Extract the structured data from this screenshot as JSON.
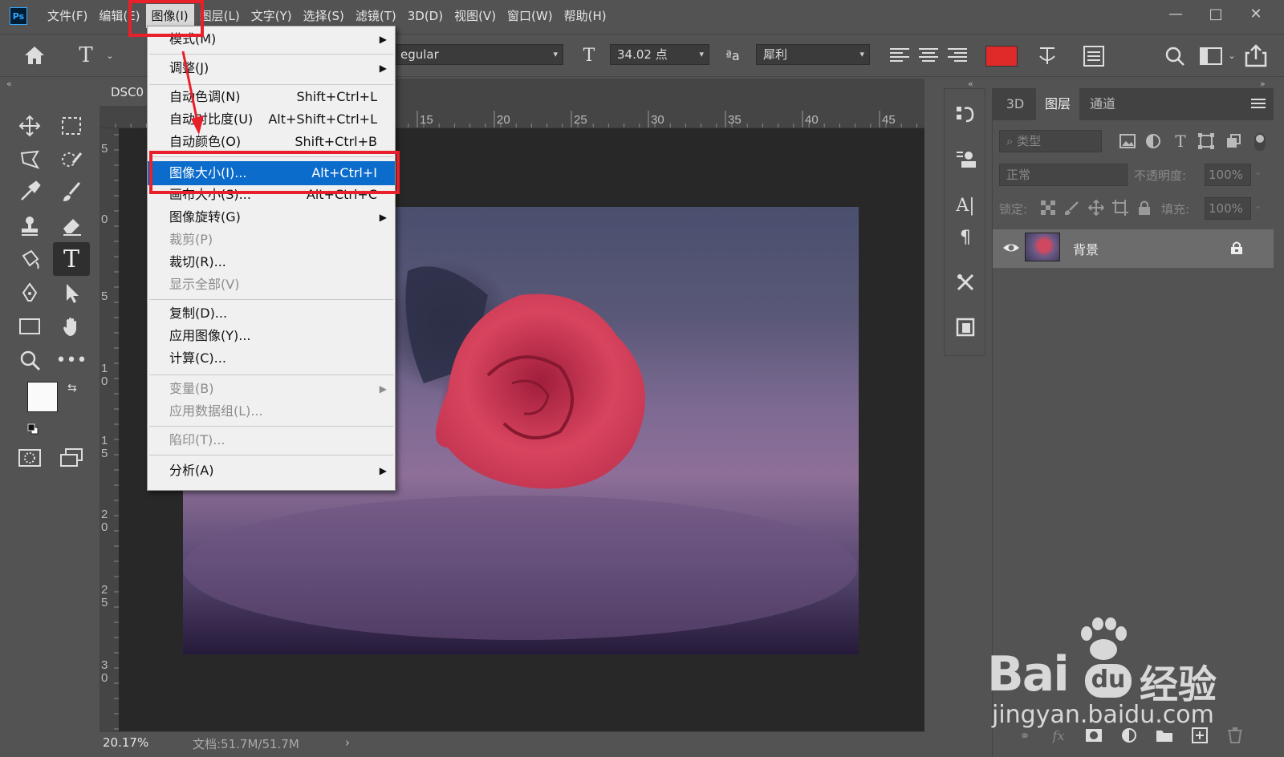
{
  "menubar": {
    "logo": "Ps",
    "items": [
      "文件(F)",
      "编辑(E)",
      "图像(I)",
      "图层(L)",
      "文字(Y)",
      "选择(S)",
      "滤镜(T)",
      "3D(D)",
      "视图(V)",
      "窗口(W)",
      "帮助(H)"
    ]
  },
  "window_controls": {
    "minimize": "—",
    "maximize": "□",
    "close": "✕"
  },
  "options": {
    "font_style": "egular",
    "font_size": "34.02 点",
    "aa_label": "ªa",
    "antialias": "犀利",
    "text_color": "#e02a2a"
  },
  "document": {
    "tab": "DSC0",
    "zoom": "20.17%",
    "doc_info": "文档:51.7M/51.7M",
    "ruler_top": [
      "15",
      "20",
      "25",
      "30",
      "35",
      "40",
      "45"
    ],
    "ruler_left": [
      "5",
      "0",
      "5",
      "1 0",
      "1 5",
      "2 0",
      "2 5",
      "3 0"
    ]
  },
  "dropdown": {
    "mode": "模式(M)",
    "adjust": "调整(J)",
    "auto_tone": "自动色调(N)",
    "auto_tone_sc": "Shift+Ctrl+L",
    "auto_contrast": "自动对比度(U)",
    "auto_contrast_sc": "Alt+Shift+Ctrl+L",
    "auto_color": "自动颜色(O)",
    "auto_color_sc": "Shift+Ctrl+B",
    "image_size": "图像大小(I)...",
    "image_size_sc": "Alt+Ctrl+I",
    "canvas_size": "画布大小(S)...",
    "canvas_size_sc": "Alt+Ctrl+C",
    "rotation": "图像旋转(G)",
    "crop": "裁剪(P)",
    "trim": "裁切(R)...",
    "reveal_all": "显示全部(V)",
    "duplicate": "复制(D)...",
    "apply_image": "应用图像(Y)...",
    "calculations": "计算(C)...",
    "variables": "变量(B)",
    "apply_dataset": "应用数据组(L)...",
    "trap": "陷印(T)...",
    "analysis": "分析(A)"
  },
  "panel": {
    "tabs": [
      "3D",
      "图层",
      "通道"
    ],
    "filter_placeholder": "类型",
    "blend_mode": "正常",
    "opacity_label": "不透明度:",
    "opacity_value": "100%",
    "lock_label": "锁定:",
    "fill_label": "填充:",
    "fill_value": "100%",
    "layer_name": "背景"
  },
  "watermark": {
    "brand": "Bai",
    "du": "du",
    "cn": "经验",
    "url": "jingyan.baidu.com"
  },
  "colors": {
    "accent": "#0c6ccc",
    "annotation": "#e8202a"
  }
}
